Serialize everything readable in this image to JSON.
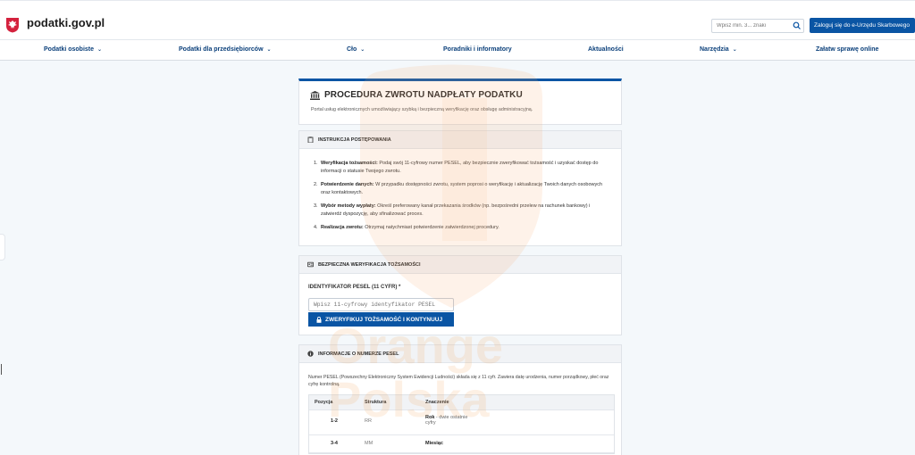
{
  "header": {
    "logo_text": "podatki.gov.pl",
    "search_placeholder": "Wpisz min. 3... znaki",
    "login_label": "Zaloguj się do e-Urzędu Skarbowego"
  },
  "nav": {
    "items": [
      {
        "label": "Podatki osobiste",
        "has_dropdown": true
      },
      {
        "label": "Podatki dla przedsiębiorców",
        "has_dropdown": true
      },
      {
        "label": "Cło",
        "has_dropdown": true
      },
      {
        "label": "Poradniki i informatory",
        "has_dropdown": false
      },
      {
        "label": "Aktualności",
        "has_dropdown": false
      },
      {
        "label": "Narzędzia",
        "has_dropdown": true
      },
      {
        "label": "Załatw sprawę online",
        "has_dropdown": false
      }
    ]
  },
  "watermark": {
    "lines": [
      "Orange",
      "Polska"
    ]
  },
  "title_card": {
    "title": "PROCEDURA ZWROTU NADPŁATY PODATKU",
    "subtitle": "Portal usług elektronicznych umożliwiający szybką i bezpieczną weryfikację oraz obsługę administracyjną."
  },
  "instructions": {
    "heading": "INSTRUKCJA POSTĘPOWANIA",
    "steps": [
      {
        "num": "1.",
        "bold": "Weryfikacja tożsamości:",
        "text": " Podaj swój 11-cyfrowy numer PESEL, aby bezpiecznie zweryfikować tożsamość i uzyskać dostęp do informacji o statusie Twojego zwrotu."
      },
      {
        "num": "2.",
        "bold": "Potwierdzenie danych:",
        "text": " W przypadku dostępności zwrotu, system poprosi o weryfikację i aktualizację Twoich danych osobowych oraz kontaktowych."
      },
      {
        "num": "3.",
        "bold": "Wybór metody wypłaty:",
        "text": " Określ preferowany kanał przekazania środków (np. bezpośredni przelew na rachunek bankowy) i zatwierdź dyspozycję, aby sfinalizować proces."
      },
      {
        "num": "4.",
        "bold": "Realizacja zwrotu:",
        "text": " Otrzymaj natychmiast potwierdzenie zatwierdzonej procedury."
      }
    ]
  },
  "verification": {
    "heading": "BEZPIECZNA WERYFIKACJA TOŻSAMOŚCI",
    "field_label": "IDENTYFIKATOR PESEL (11 CYFR) *",
    "input_placeholder": "Wpisz 11-cyfrowy identyfikator PESEL",
    "button_label": "ZWERYFIKUJ TOŻSAMOŚĆ I KONTYNUUJ"
  },
  "pesel_info": {
    "heading": "INFORMACJE O NUMERZE PESEL",
    "description": "Numer PESEL (Powszechny Elektroniczny System Ewidencji Ludności) składa się z 11 cyfr. Zawiera datę urodzenia, numer porządkowy, płeć oraz cyfrę kontrolną.",
    "columns": [
      "Pozycja",
      "Struktura",
      "Znaczenie"
    ],
    "rows": [
      {
        "position": "1-2",
        "structure": "RR",
        "meaning_bold": "Rok",
        "meaning_rest": " - dwie ostatnie cyfry"
      },
      {
        "position": "3-4",
        "structure": "MM",
        "meaning_bold": "Miesiąc",
        "meaning_rest": ""
      }
    ]
  },
  "colors": {
    "brand_blue": "#0a55a4",
    "nav_text": "#0a3f7a",
    "page_bg": "#f4f8fb",
    "emblem_red": "#d4213d"
  }
}
